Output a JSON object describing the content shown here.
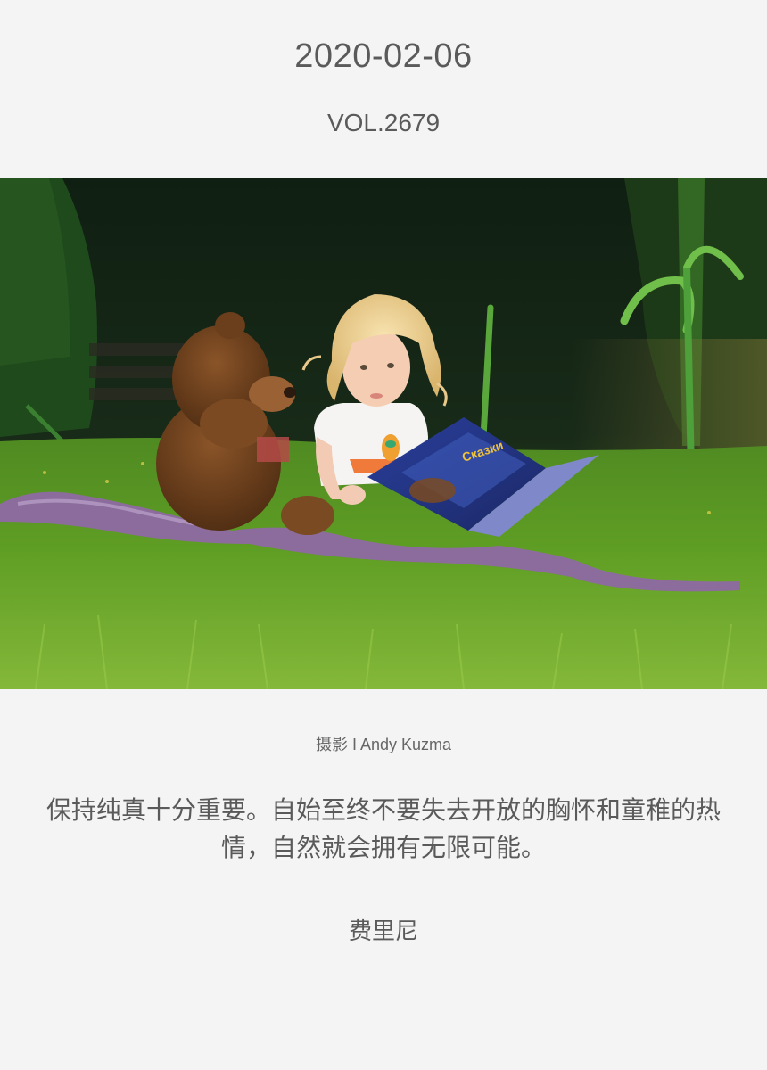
{
  "header": {
    "date": "2020-02-06",
    "volume": "VOL.2679"
  },
  "photo": {
    "book_title": "Сказки"
  },
  "credit": {
    "text": "摄影 I Andy Kuzma"
  },
  "quote": {
    "text": "保持纯真十分重要。自始至终不要失去开放的胸怀和童稚的热情，自然就会拥有无限可能。",
    "author": "费里尼"
  },
  "colors": {
    "background": "#f4f4f4",
    "text": "#5a5a5a"
  }
}
